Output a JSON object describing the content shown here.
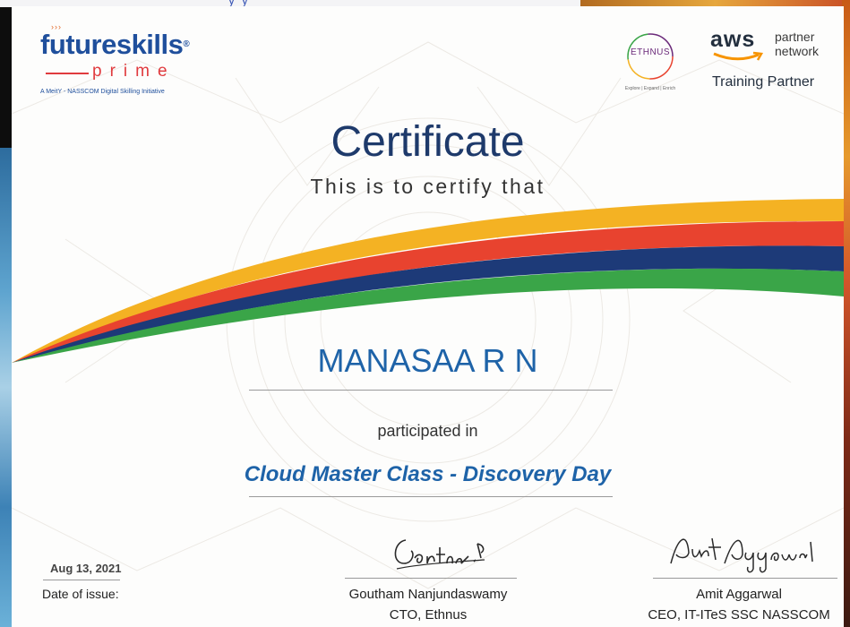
{
  "background": {
    "top_fragment": "y y",
    "colors": {
      "right_edge": "#d3552a",
      "left_edge": "#5ea4cf"
    }
  },
  "logos": {
    "futureskills": {
      "word_1": "future",
      "word_2": "skills",
      "registered": "®",
      "prime": "prime",
      "tagline": "A MeitY - NASSCOM Digital Skilling Initiative"
    },
    "ethnus": {
      "name": "ETHNUS",
      "tagline": "Explore | Expand | Enrich"
    },
    "aws": {
      "brand": "aws",
      "partner_network": "partner network",
      "training_partner": "Training Partner"
    }
  },
  "certificate": {
    "title": "Certificate",
    "subtitle": "This is to certify that",
    "recipient_name": "MANASAA R N",
    "participated_text": "participated in",
    "course_name": "Cloud Master Class - Discovery Day",
    "issue_date": "Aug 13, 2021",
    "issue_date_label": "Date of issue:",
    "signatories": [
      {
        "signature": "Goutham.N",
        "name": "Goutham Nanjundaswamy",
        "role": "CTO, Ethnus"
      },
      {
        "signature": "Amit Aggarwal",
        "name": "Amit Aggarwal",
        "role": "CEO, IT-ITeS SSC NASSCOM"
      }
    ]
  },
  "colors": {
    "title": "#1e3a6b",
    "name": "#1e63a8",
    "ribbon": [
      "#f4b223",
      "#e8432f",
      "#1d3a78",
      "#3aa548"
    ]
  }
}
